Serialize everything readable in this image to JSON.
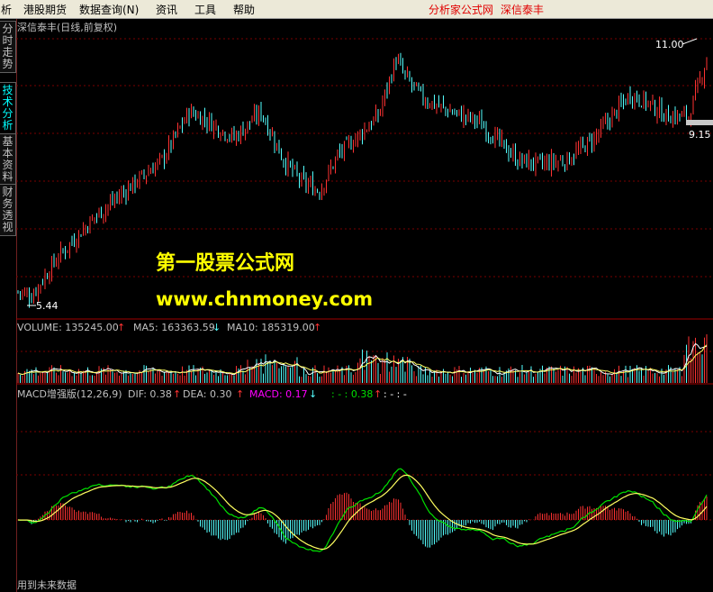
{
  "menu": {
    "items": [
      "析",
      "港股期货",
      "数据查询(N)",
      "资讯",
      "工具",
      "帮助"
    ],
    "title": "分析家公式网",
    "stock": "深信泰丰"
  },
  "sidebar": {
    "tabs": [
      {
        "label": "分时走势",
        "active": false
      },
      {
        "label": "技术分析",
        "active": true
      },
      {
        "label": "基本资料",
        "active": false
      },
      {
        "label": "财务透视",
        "active": false
      }
    ]
  },
  "main_panel": {
    "header": "深信泰丰(日线,前复权)",
    "high_label": "11.00",
    "low_label": "5.44",
    "last_label": "9.15",
    "watermark_line1": "第一股票公式网",
    "watermark_line2": "www.chnmoney.com"
  },
  "volume_panel": {
    "label_volume": "VOLUME: 135245.00",
    "label_ma5": "MA5: 163363.59",
    "label_ma10": "MA10: 185319.00"
  },
  "macd_panel": {
    "label_name": "MACD增强版(12,26,9)",
    "label_dif": "DIF: 0.38",
    "label_dea": "DEA: 0.30",
    "label_macd": "MACD: 0.17",
    "label_extra1": ": - : 0.38",
    "label_extra2": ": - : -",
    "footer": "用到未来数据"
  },
  "colors": {
    "up": "#ff3232",
    "down": "#54ffff",
    "dif": "#00e000",
    "dea": "#ffff60",
    "grid": "#7a0000",
    "macd_label": "#ff00ff"
  }
}
